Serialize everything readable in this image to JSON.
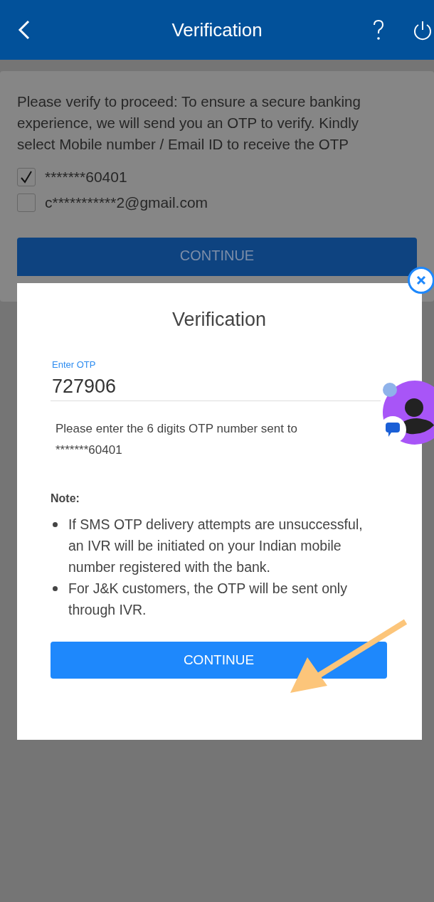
{
  "header": {
    "title": "Verification"
  },
  "prompt": "Please verify to proceed: To ensure a secure banking experience, we will send you an OTP to verify. Kindly select Mobile number / Email ID to receive the OTP",
  "options": [
    {
      "label": "*******60401",
      "checked": true
    },
    {
      "label": "c***********2@gmail.com",
      "checked": false
    }
  ],
  "background_button": "CONTINUE",
  "dialog": {
    "title": "Verification",
    "otp_field": {
      "label": "Enter OTP",
      "value": "727906"
    },
    "hint": "Please enter the 6 digits OTP number sent to *******60401",
    "note_title": "Note:",
    "notes": [
      "If SMS OTP delivery attempts are unsuccessful, an IVR will be initiated on your Indian mobile number registered with the bank.",
      "For J&K customers, the OTP will be sent only through IVR."
    ],
    "button": "CONTINUE"
  }
}
